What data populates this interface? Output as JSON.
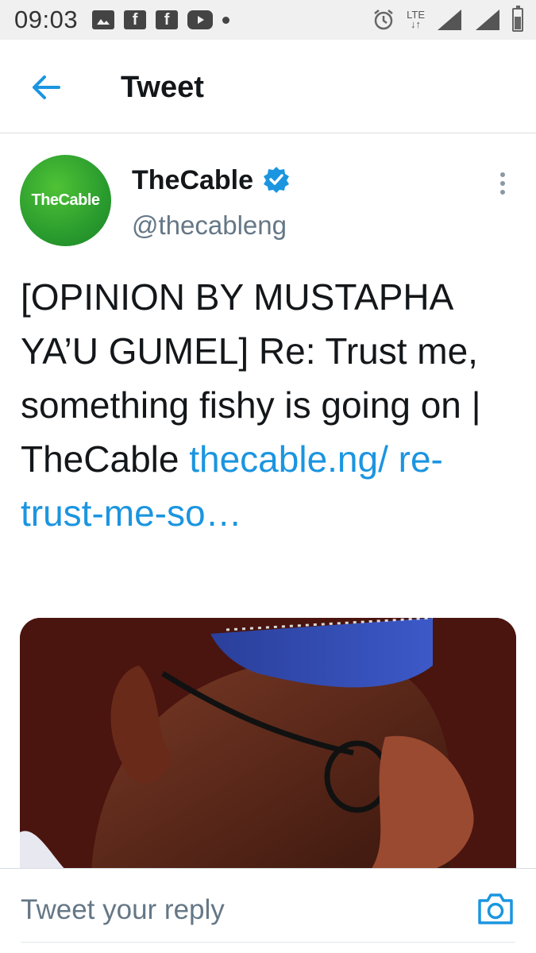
{
  "status_bar": {
    "time": "09:03",
    "network": "LTE",
    "icons": [
      "image-icon",
      "facebook-icon",
      "facebook-icon",
      "youtube-icon",
      "dot-icon",
      "alarm-icon",
      "signal-icon",
      "signal-icon",
      "battery-icon"
    ]
  },
  "header": {
    "back_icon": "arrow-left-icon",
    "title": "Tweet"
  },
  "tweet": {
    "author": {
      "avatar_text": "TheCable",
      "name": "TheCable",
      "verified": true,
      "handle": "@thecableng"
    },
    "text": "[OPINION BY MUSTAPHA YA’U GUMEL] Re: Trust me, something fishy is going on | TheCable ",
    "link": "thecable.ng/ re-trust-me-so…",
    "media_description_icon": "photo-icon"
  },
  "reply": {
    "placeholder": "Tweet your reply",
    "camera_icon": "camera-icon"
  },
  "colors": {
    "accent": "#1b95e0",
    "text": "#14171a",
    "secondary": "#657786",
    "avatar_green": "#2a9c2e"
  }
}
